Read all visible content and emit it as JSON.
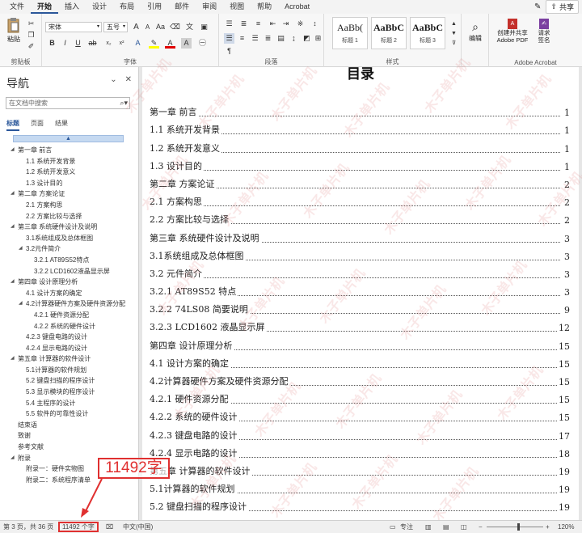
{
  "ribbon": {
    "tabs": [
      "文件",
      "开始",
      "插入",
      "设计",
      "布局",
      "引用",
      "邮件",
      "审阅",
      "视图",
      "帮助",
      "Acrobat"
    ],
    "active_tab": "开始",
    "share_label": "共享",
    "clipboard": {
      "paste_label": "粘贴",
      "group_label": "剪贴板"
    },
    "font": {
      "family": "宋体",
      "size": "五号",
      "grow": "A",
      "shrink": "A",
      "aa": "Aa",
      "group_label": "字体"
    },
    "paragraph": {
      "group_label": "段落"
    },
    "styles": {
      "group_label": "样式",
      "items": [
        {
          "sample": "AaBb(",
          "name": "标题 1"
        },
        {
          "sample": "AaBbC",
          "name": "标题 2"
        },
        {
          "sample": "AaBbC",
          "name": "标题 3"
        }
      ]
    },
    "editing": {
      "label": "编辑"
    },
    "acrobat": {
      "create_pdf": "创建并共享 Adobe PDF",
      "request_sign": "请求 签名",
      "group_label": "Adobe Acrobat"
    }
  },
  "nav": {
    "title": "导航",
    "search_placeholder": "在文档中搜索",
    "tabs": [
      "标题",
      "页面",
      "结果"
    ],
    "active_tab": "标题",
    "tree": [
      {
        "label": "第一章 前言",
        "level": 1,
        "tri": true
      },
      {
        "label": "1.1 系统开发背景",
        "level": 2
      },
      {
        "label": "1.2 系统开发意义",
        "level": 2
      },
      {
        "label": "1.3 设计目的",
        "level": 2
      },
      {
        "label": "第二章 方案论证",
        "level": 1,
        "tri": true
      },
      {
        "label": "2.1 方案构思",
        "level": 2
      },
      {
        "label": "2.2 方案比较与选择",
        "level": 2
      },
      {
        "label": "第三章 系统硬件设计及说明",
        "level": 1,
        "tri": true
      },
      {
        "label": "3.1系统组成及总体框图",
        "level": 2
      },
      {
        "label": "3.2元件简介",
        "level": 2,
        "tri": true
      },
      {
        "label": "3.2.1 AT89S52特点",
        "level": 3
      },
      {
        "label": "3.2.2 LCD1602液晶显示屏",
        "level": 3
      },
      {
        "label": "第四章 设计原理分析",
        "level": 1,
        "tri": true
      },
      {
        "label": "4.1 设计方案的确定",
        "level": 2
      },
      {
        "label": "4.2计算器硬件方案及硬件资源分配",
        "level": 2,
        "tri": true
      },
      {
        "label": "4.2.1 硬件资源分配",
        "level": 3
      },
      {
        "label": "4.2.2 系统的硬件设计",
        "level": 3
      },
      {
        "label": "4.2.3 键盘电路的设计",
        "level": 2
      },
      {
        "label": "4.2.4 显示电路的设计",
        "level": 2
      },
      {
        "label": "第五章 计算器的软件设计",
        "level": 1,
        "tri": true
      },
      {
        "label": "5.1计算器的软件规划",
        "level": 2
      },
      {
        "label": "5.2 键盘扫描的程序设计",
        "level": 2
      },
      {
        "label": "5.3 显示模块的程序设计",
        "level": 2
      },
      {
        "label": "5.4 主程序的设计",
        "level": 2
      },
      {
        "label": "5.5 软件的可靠性设计",
        "level": 2
      },
      {
        "label": "结束语",
        "level": 1
      },
      {
        "label": "致谢",
        "level": 1
      },
      {
        "label": "参考文献",
        "level": 1
      },
      {
        "label": "附录",
        "level": 1,
        "tri": true
      },
      {
        "label": "附录一：硬件实物图",
        "level": 2
      },
      {
        "label": "附录二：系统程序清单",
        "level": 2
      }
    ]
  },
  "document": {
    "heading": "目录",
    "toc": [
      {
        "text": "第一章 前言",
        "page": "1"
      },
      {
        "text": "1.1 系统开发背景",
        "page": "1"
      },
      {
        "text": "1.2 系统开发意义",
        "page": "1"
      },
      {
        "text": "1.3 设计目的",
        "page": "1"
      },
      {
        "text": "第二章 方案论证",
        "page": "2"
      },
      {
        "text": "2.1 方案构思",
        "page": "2"
      },
      {
        "text": "2.2  方案比较与选择",
        "page": "2"
      },
      {
        "text": "第三章 系统硬件设计及说明",
        "page": "3"
      },
      {
        "text": "3.1系统组成及总体框图",
        "page": "3"
      },
      {
        "text": "3.2 元件简介",
        "page": "3"
      },
      {
        "text": "3.2.1 AT89S52 特点",
        "page": "3"
      },
      {
        "text": "3.2.2 74LS08 简要说明",
        "page": "9"
      },
      {
        "text": "3.2.3 LCD1602 液晶显示屏",
        "page": "12"
      },
      {
        "text": "第四章 设计原理分析",
        "page": "15"
      },
      {
        "text": "4.1  设计方案的确定",
        "page": "15"
      },
      {
        "text": "4.2计算器硬件方案及硬件资源分配",
        "page": "15"
      },
      {
        "text": "4.2.1 硬件资源分配",
        "page": "15"
      },
      {
        "text": "4.2.2 系统的硬件设计",
        "page": "15"
      },
      {
        "text": "4.2.3 键盘电路的设计",
        "page": "17"
      },
      {
        "text": "4.2.4 显示电路的设计",
        "page": "18"
      },
      {
        "text": "第五章 计算器的软件设计",
        "page": "19"
      },
      {
        "text": "5.1计算器的软件规划",
        "page": "19"
      },
      {
        "text": "5.2 键盘扫描的程序设计",
        "page": "19"
      }
    ]
  },
  "watermark": "木子单片机",
  "annotation": {
    "text": "11492字"
  },
  "statusbar": {
    "page_info": "第 3 页，共 36 页",
    "word_count": "11492 个字",
    "language": "中文(中国)",
    "focus": "专注",
    "zoom": "120%"
  }
}
